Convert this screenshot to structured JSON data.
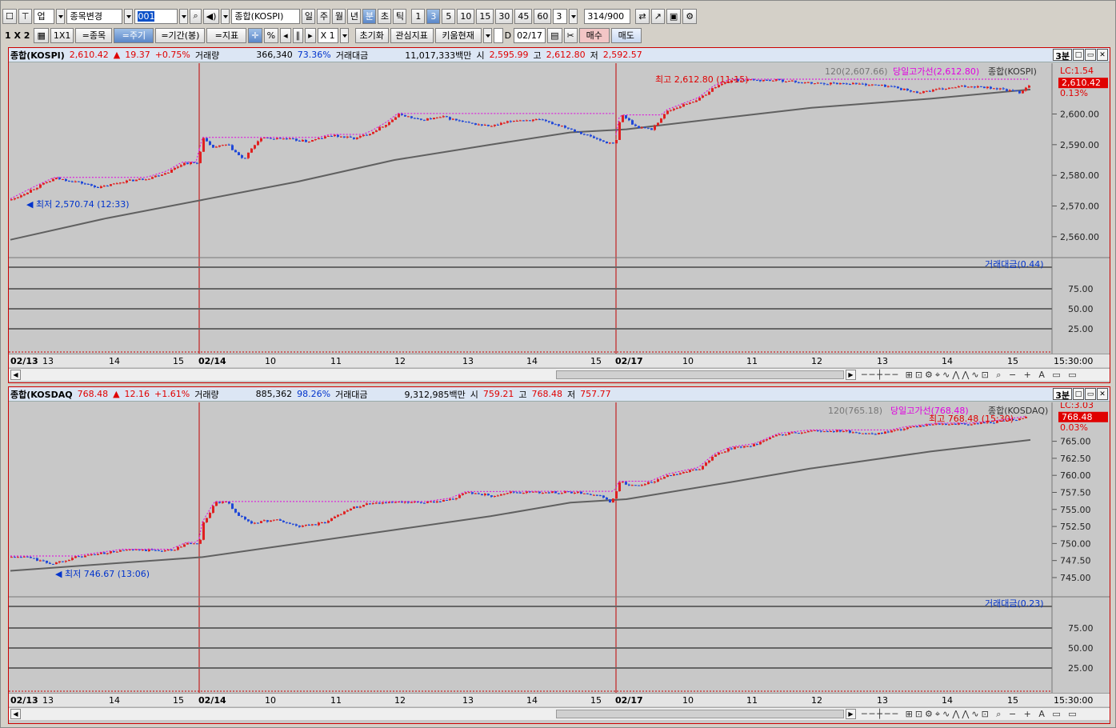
{
  "toolbar1": {
    "market": "업",
    "stock_change": "종목변경",
    "code": "001",
    "name": "종합(KOSPI)",
    "periods": [
      "일",
      "주",
      "월",
      "년",
      "분",
      "초",
      "틱"
    ],
    "intervals": [
      "1",
      "3",
      "5",
      "10",
      "15",
      "30",
      "45",
      "60"
    ],
    "interval_select": "3",
    "count": "314",
    "count_max": "/900"
  },
  "toolbar2": {
    "layout": "1 X 2",
    "one": "1X1",
    "stock": "=종목",
    "cycle": "=주기",
    "period": "=기간(봉)",
    "indicator": "=지표",
    "pct": "%",
    "multiplier": "X 1",
    "reset": "초기화",
    "watch": "관심지표",
    "kiwoom": "키움현재",
    "d_label": "D",
    "date": "02/17",
    "buy": "매수",
    "sell": "매도"
  },
  "panels": [
    {
      "name": "종합(KOSPI)",
      "price": "2,610.42",
      "arrow": "▲",
      "change": "19.37",
      "pct": "+0.75%",
      "vol_label": "거래량",
      "vol": "366,340",
      "vol_pct": "73.36%",
      "amt_label": "거래대금",
      "amt": "11,017,333백만",
      "open_label": "시",
      "open": "2,595.99",
      "high_label": "고",
      "high": "2,612.80",
      "low_label": "저",
      "low": "2,592.57",
      "timeframe": "3분",
      "legend_ma": "120(2,607.66)",
      "legend_hl": "당일고가선(2,612.80)",
      "legend_name": "종합(KOSPI)",
      "lc": "LC:1.54",
      "cur_tag": "2,610.42",
      "cur_pct": "0.13%",
      "hi_note": "최고 2,612.80 (11:15)",
      "lo_note": "최저 2,570.74 (12:33)",
      "amt_legend": "거래대금(0.44)",
      "yticks": [
        "2,600.00",
        "2,590.00",
        "2,580.00",
        "2,570.00",
        "2,560.00"
      ],
      "sub_ticks": [
        "75.00",
        "50.00",
        "25.00"
      ],
      "dates": [
        "02/13",
        "13",
        "14",
        "15",
        "02/14",
        "10",
        "11",
        "12",
        "13",
        "14",
        "15",
        "02/17",
        "10",
        "11",
        "12",
        "13",
        "14",
        "15"
      ],
      "time_label": "15:30:00"
    },
    {
      "name": "종합(KOSDAQ",
      "price": "768.48",
      "arrow": "▲",
      "change": "12.16",
      "pct": "+1.61%",
      "vol_label": "거래량",
      "vol": "885,362",
      "vol_pct": "98.26%",
      "amt_label": "거래대금",
      "amt": "9,312,985백만",
      "open_label": "시",
      "open": "759.21",
      "high_label": "고",
      "high": "768.48",
      "low_label": "저",
      "low": "757.77",
      "timeframe": "3분",
      "legend_ma": "120(765.18)",
      "legend_hl": "당일고가선(768.48)",
      "legend_name": "종합(KOSDAQ)",
      "lc": "LC:3.03",
      "cur_tag": "768.48",
      "cur_pct": "0.03%",
      "hi_note": "최고 768.48 (15:30)",
      "lo_note": "최저 746.67 (13:06)",
      "amt_legend": "거래대금(0.23)",
      "yticks": [
        "765.00",
        "762.50",
        "760.00",
        "757.50",
        "755.00",
        "752.50",
        "750.00",
        "747.50",
        "745.00"
      ],
      "sub_ticks": [
        "75.00",
        "50.00",
        "25.00"
      ],
      "dates": [
        "02/13",
        "13",
        "14",
        "15",
        "02/14",
        "10",
        "11",
        "12",
        "13",
        "14",
        "15",
        "02/17",
        "10",
        "11",
        "12",
        "13",
        "14",
        "15"
      ],
      "time_label": "15:30:00"
    }
  ],
  "chart_data": [
    {
      "type": "candlestick",
      "title": "종합(KOSPI) 3분",
      "ylim": [
        2555,
        2615
      ],
      "ma": "120",
      "days": [
        "02/13",
        "02/14",
        "02/17"
      ],
      "close_path": [
        [
          0,
          2572
        ],
        [
          30,
          2576
        ],
        [
          55,
          2579
        ],
        [
          80,
          2578
        ],
        [
          110,
          2576
        ],
        [
          140,
          2578
        ],
        [
          170,
          2579
        ],
        [
          195,
          2581
        ],
        [
          215,
          2584
        ],
        [
          232,
          2584
        ],
        [
          240,
          2592
        ],
        [
          250,
          2589
        ],
        [
          270,
          2590
        ],
        [
          290,
          2585
        ],
        [
          310,
          2592
        ],
        [
          340,
          2592
        ],
        [
          370,
          2591
        ],
        [
          400,
          2593
        ],
        [
          430,
          2592
        ],
        [
          450,
          2594
        ],
        [
          470,
          2597
        ],
        [
          485,
          2600
        ],
        [
          510,
          2598
        ],
        [
          540,
          2599
        ],
        [
          570,
          2597
        ],
        [
          600,
          2596
        ],
        [
          630,
          2598
        ],
        [
          660,
          2598
        ],
        [
          690,
          2596
        ],
        [
          720,
          2593
        ],
        [
          740,
          2591
        ],
        [
          755,
          2590
        ],
        [
          762,
          2600
        ],
        [
          780,
          2596
        ],
        [
          800,
          2595
        ],
        [
          820,
          2601
        ],
        [
          840,
          2603
        ],
        [
          860,
          2605
        ],
        [
          880,
          2609
        ],
        [
          900,
          2611
        ],
        [
          930,
          2611
        ],
        [
          960,
          2611
        ],
        [
          1000,
          2610
        ],
        [
          1050,
          2610
        ],
        [
          1100,
          2609
        ],
        [
          1130,
          2607
        ],
        [
          1160,
          2608
        ],
        [
          1190,
          2609
        ],
        [
          1210,
          2609
        ],
        [
          1240,
          2608
        ],
        [
          1260,
          2607
        ],
        [
          1275,
          2610
        ]
      ],
      "ma_path": [
        [
          0,
          2559
        ],
        [
          120,
          2566
        ],
        [
          240,
          2572
        ],
        [
          360,
          2578
        ],
        [
          480,
          2585
        ],
        [
          600,
          2590
        ],
        [
          700,
          2594
        ],
        [
          770,
          2595
        ],
        [
          900,
          2599
        ],
        [
          1000,
          2602
        ],
        [
          1150,
          2605
        ],
        [
          1275,
          2608
        ]
      ]
    },
    {
      "type": "candlestick",
      "title": "종합(KOSDAQ) 3분",
      "ylim": [
        743,
        770
      ],
      "ma": "120",
      "days": [
        "02/13",
        "02/14",
        "02/17"
      ],
      "close_path": [
        [
          0,
          748
        ],
        [
          20,
          748
        ],
        [
          50,
          747
        ],
        [
          80,
          748
        ],
        [
          110,
          748.5
        ],
        [
          140,
          749
        ],
        [
          170,
          749
        ],
        [
          200,
          749
        ],
        [
          220,
          750
        ],
        [
          235,
          750
        ],
        [
          240,
          753
        ],
        [
          255,
          756
        ],
        [
          270,
          756
        ],
        [
          285,
          754
        ],
        [
          300,
          753
        ],
        [
          330,
          753.5
        ],
        [
          360,
          752.5
        ],
        [
          390,
          753
        ],
        [
          420,
          755
        ],
        [
          450,
          756
        ],
        [
          480,
          756
        ],
        [
          520,
          756
        ],
        [
          550,
          756.5
        ],
        [
          570,
          757.5
        ],
        [
          600,
          757
        ],
        [
          620,
          757.5
        ],
        [
          650,
          757.5
        ],
        [
          680,
          757.5
        ],
        [
          710,
          757.5
        ],
        [
          735,
          757
        ],
        [
          750,
          756
        ],
        [
          760,
          759
        ],
        [
          780,
          758.5
        ],
        [
          800,
          759
        ],
        [
          820,
          760
        ],
        [
          840,
          760.5
        ],
        [
          860,
          761
        ],
        [
          880,
          763
        ],
        [
          900,
          764
        ],
        [
          930,
          764.5
        ],
        [
          960,
          766
        ],
        [
          1000,
          766.5
        ],
        [
          1040,
          766.5
        ],
        [
          1080,
          766
        ],
        [
          1120,
          767
        ],
        [
          1160,
          767.5
        ],
        [
          1200,
          767.5
        ],
        [
          1240,
          768
        ],
        [
          1270,
          768.5
        ]
      ],
      "ma_path": [
        [
          0,
          746
        ],
        [
          120,
          747
        ],
        [
          240,
          748
        ],
        [
          360,
          750
        ],
        [
          480,
          752
        ],
        [
          600,
          754
        ],
        [
          700,
          756
        ],
        [
          770,
          756.5
        ],
        [
          900,
          759
        ],
        [
          1000,
          761
        ],
        [
          1150,
          763.5
        ],
        [
          1275,
          765.2
        ]
      ]
    }
  ],
  "colors": {
    "up": "#e02020",
    "down": "#1f47d8",
    "ma": "#606060",
    "highline": "#e000e0",
    "dayline": "#c00000"
  }
}
